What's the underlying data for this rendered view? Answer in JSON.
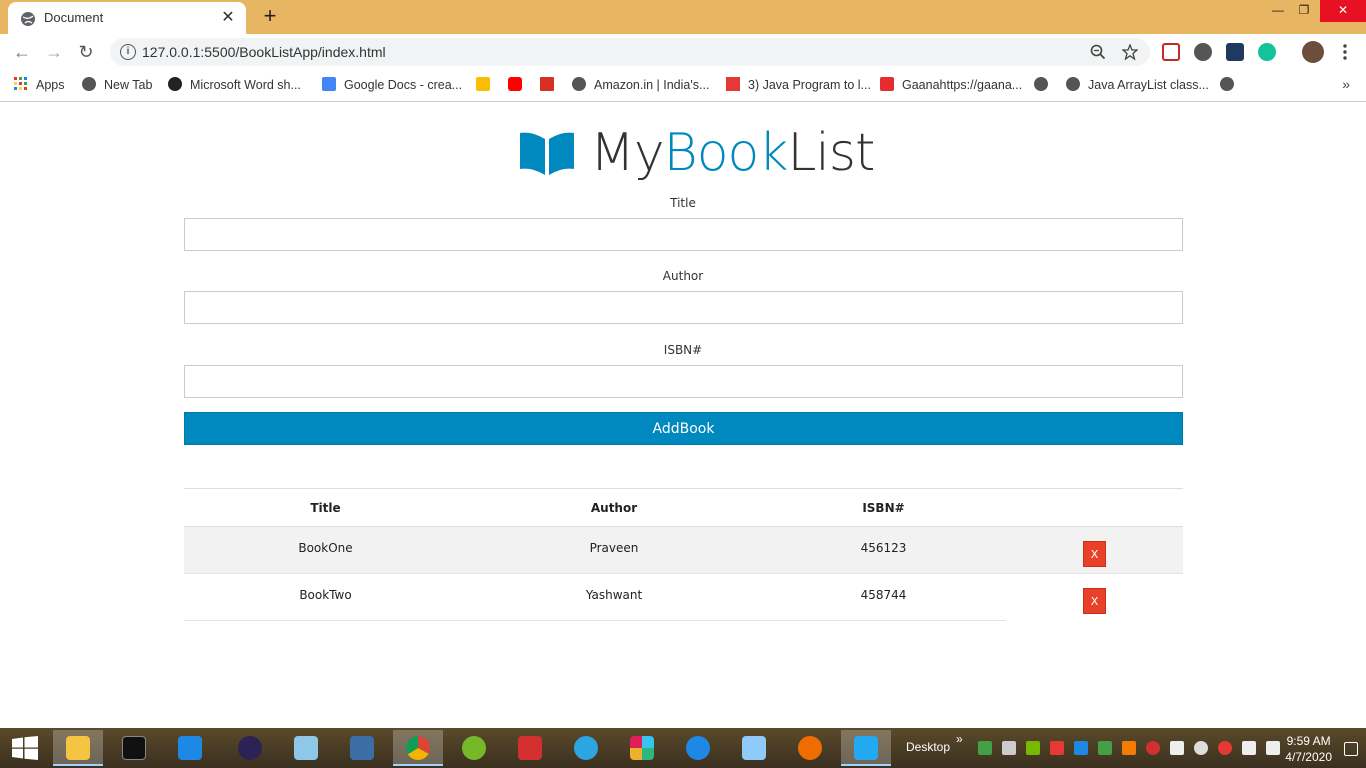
{
  "browser": {
    "tab_title": "Document",
    "tab_close": "✕",
    "new_tab": "+",
    "url": "127.0.0.1:5500/BookListApp/index.html",
    "info": "i",
    "back": "←",
    "forward": "→",
    "reload": "↻",
    "window_controls": {
      "minimize": "—",
      "restore": "❐",
      "close": "✕"
    },
    "bookmarks": [
      "Apps",
      "New Tab",
      "Microsoft Word sh...",
      "Google Docs - crea...",
      "Amazon.in | India's...",
      "3) Java Program to l...",
      "Gaanahttps://gaana...",
      "Java ArrayList class..."
    ],
    "more_bookmarks": "»"
  },
  "app": {
    "logo": {
      "prefix": "My",
      "accent": "Book",
      "suffix": "List",
      "accent_color": "#0089bf"
    },
    "form": {
      "title_label": "Title",
      "author_label": "Author",
      "isbn_label": "ISBN#",
      "title_value": "",
      "author_value": "",
      "isbn_value": "",
      "submit_label": "AddBook",
      "submit_color": "#0089bf"
    },
    "table": {
      "headers": [
        "Title",
        "Author",
        "ISBN#"
      ],
      "rows": [
        {
          "title": "BookOne",
          "author": "Praveen",
          "isbn": "456123",
          "delete": "X"
        },
        {
          "title": "BookTwo",
          "author": "Yashwant",
          "isbn": "458744",
          "delete": "X"
        }
      ],
      "delete_color": "#e8412a"
    }
  },
  "taskbar": {
    "desktop_label": "Desktop",
    "chevron": "»",
    "time": "9:59 AM",
    "date": "4/7/2020"
  }
}
